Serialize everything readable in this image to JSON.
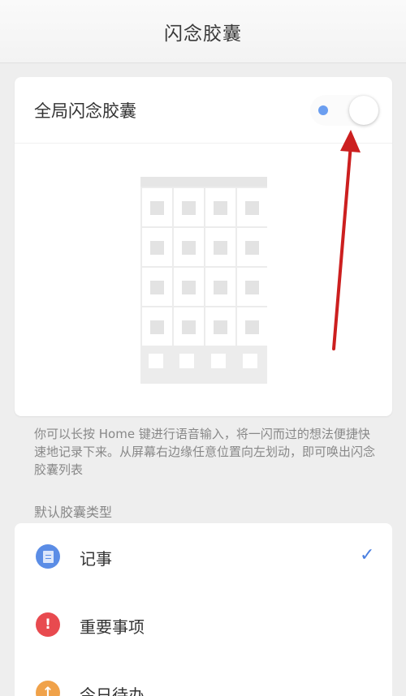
{
  "header": {
    "title": "闪念胶囊"
  },
  "global_toggle": {
    "label": "全局闪念胶囊",
    "state": "on",
    "accent": "#6b9ef0"
  },
  "description": "你可以长按 Home 键进行语音输入，将一闪而过的想法便捷快速地记录下来。从屏幕右边缘任意位置向左划动，即可唤出闪念胶囊列表",
  "capsule_types": {
    "title": "默认胶囊类型",
    "items": [
      {
        "label": "记事",
        "icon": "notepad-icon",
        "color": "#5b8de6",
        "selected": true
      },
      {
        "label": "重要事项",
        "icon": "exclamation-icon",
        "symbol": "!",
        "color": "#e84a4f",
        "selected": false
      },
      {
        "label": "今日待办",
        "icon": "todo-icon",
        "symbol": "↑",
        "color": "#f0a24a",
        "selected": false
      }
    ],
    "check_glyph": "✓"
  },
  "annotation": {
    "arrow_color": "#cc1f1f"
  }
}
